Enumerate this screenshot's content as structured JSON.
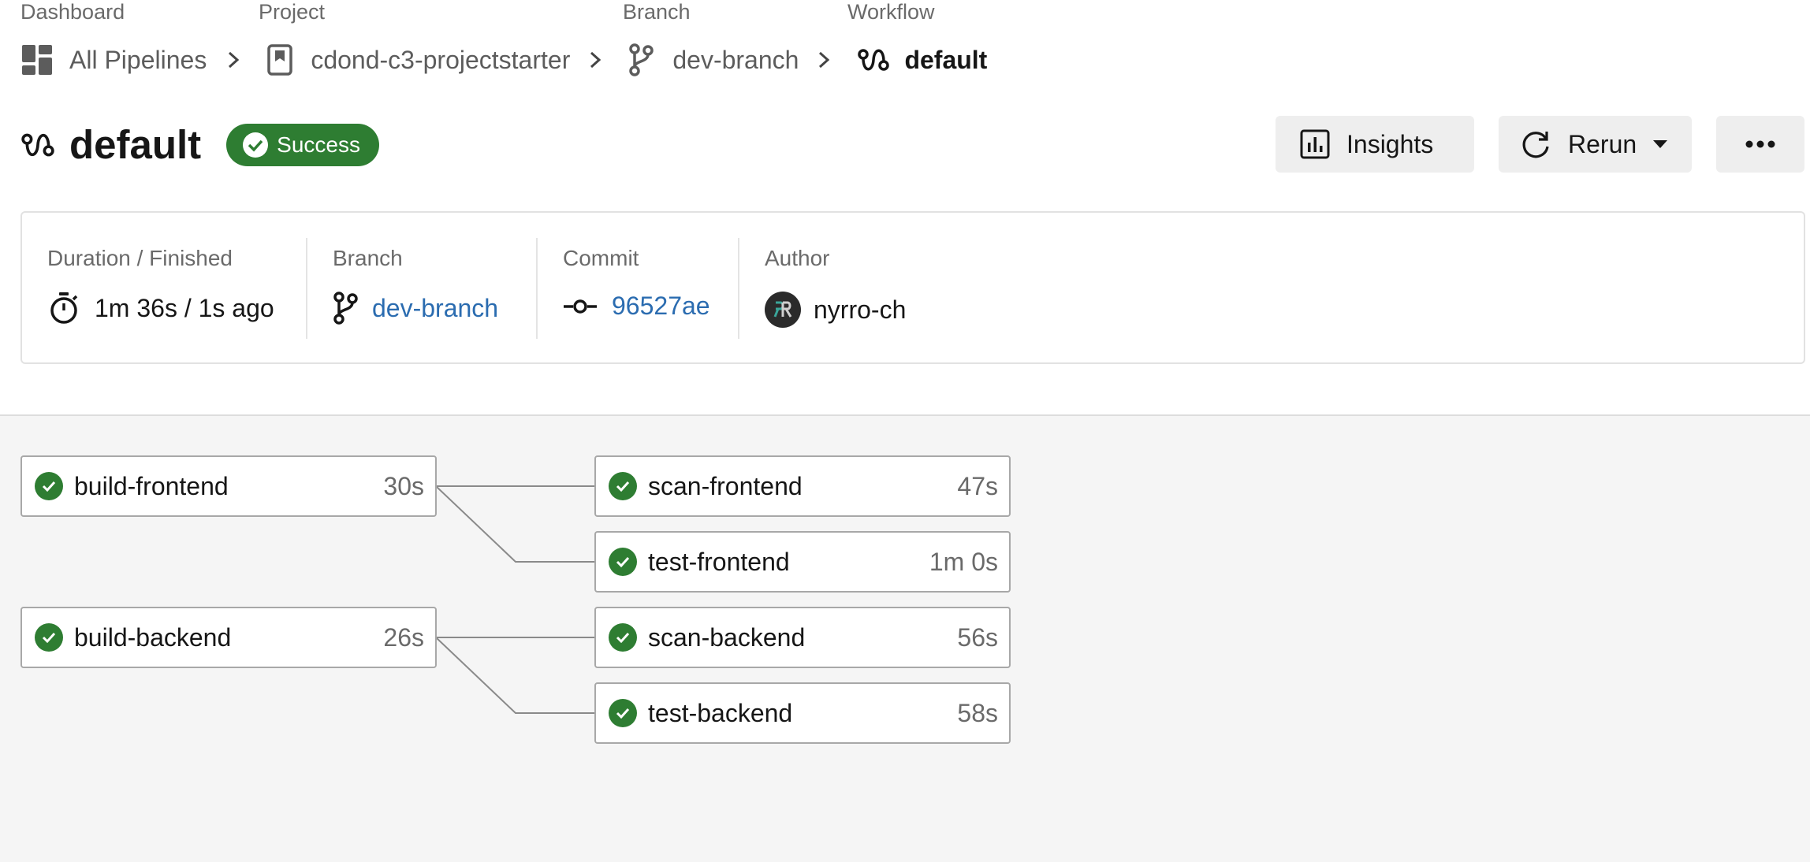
{
  "breadcrumb": {
    "dashboard": {
      "label": "Dashboard",
      "value": "All Pipelines"
    },
    "project": {
      "label": "Project",
      "value": "cdond-c3-projectstarter"
    },
    "branch": {
      "label": "Branch",
      "value": "dev-branch"
    },
    "workflow": {
      "label": "Workflow",
      "value": "default"
    }
  },
  "header": {
    "title": "default",
    "status": "Success",
    "status_color": "#2e7d32",
    "insights_label": "Insights",
    "rerun_label": "Rerun"
  },
  "info": {
    "duration": {
      "label": "Duration / Finished",
      "value": "1m 36s / 1s ago"
    },
    "branch": {
      "label": "Branch",
      "value": "dev-branch"
    },
    "commit": {
      "label": "Commit",
      "value": "96527ae"
    },
    "author": {
      "label": "Author",
      "value": "nyrro-ch"
    }
  },
  "jobs": [
    {
      "name": "build-frontend",
      "duration": "30s",
      "status": "success"
    },
    {
      "name": "scan-frontend",
      "duration": "47s",
      "status": "success"
    },
    {
      "name": "test-frontend",
      "duration": "1m 0s",
      "status": "success"
    },
    {
      "name": "build-backend",
      "duration": "26s",
      "status": "success"
    },
    {
      "name": "scan-backend",
      "duration": "56s",
      "status": "success"
    },
    {
      "name": "test-backend",
      "duration": "58s",
      "status": "success"
    }
  ],
  "colors": {
    "link": "#2b6cb0",
    "success": "#2e7d32"
  }
}
